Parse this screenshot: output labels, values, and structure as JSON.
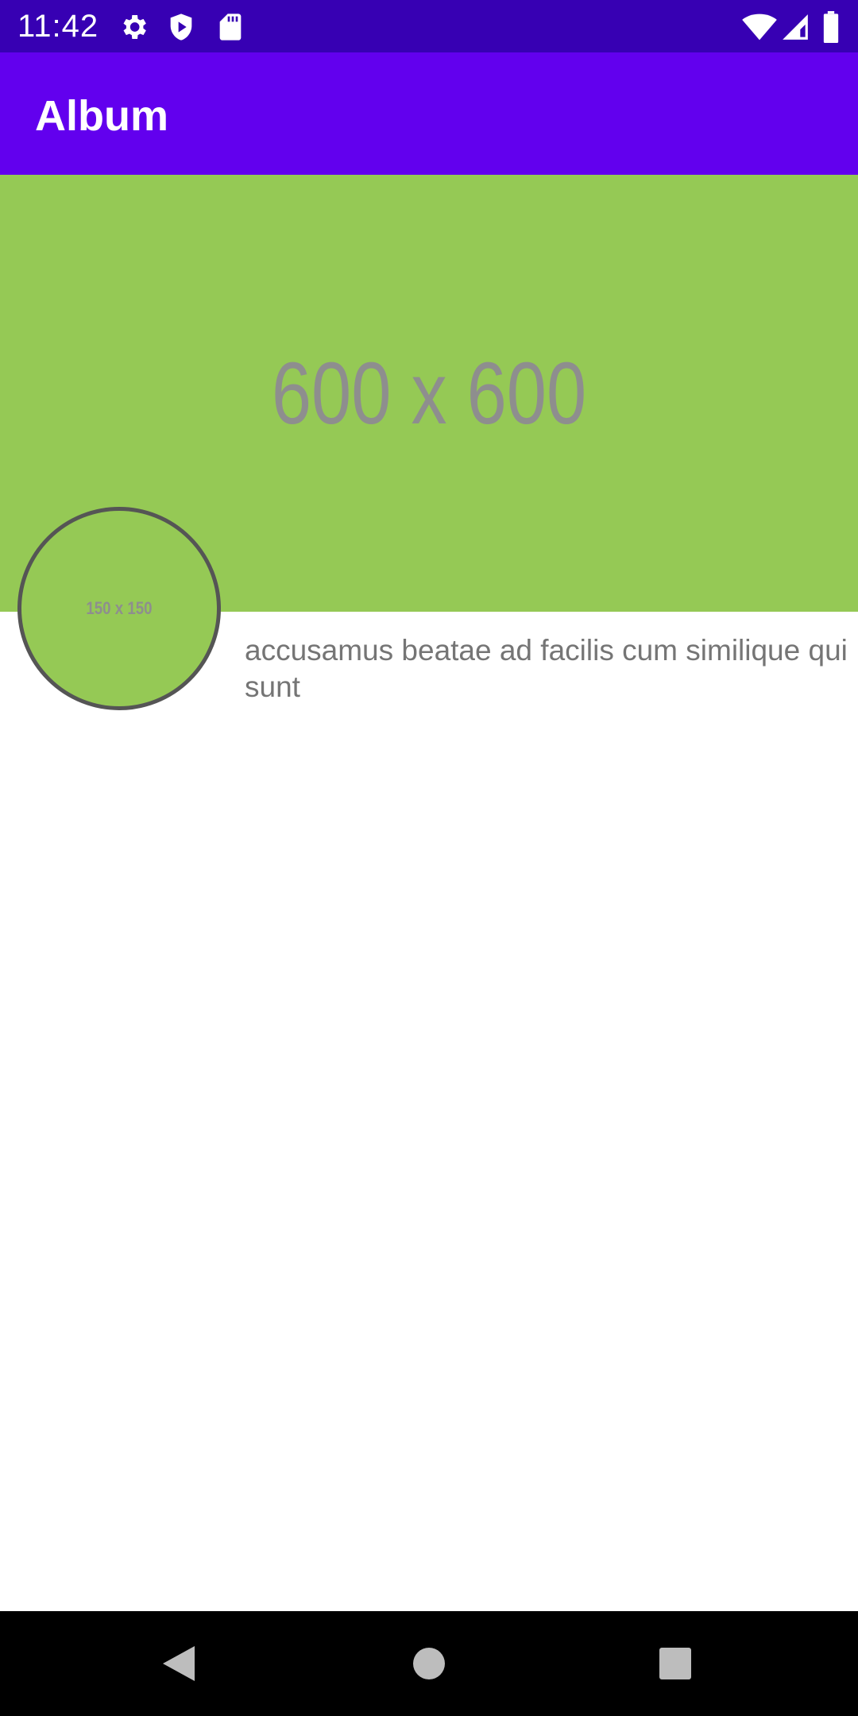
{
  "status_bar": {
    "time": "11:42",
    "icons_left": [
      "gear-icon",
      "shield-play-icon",
      "sd-card-icon"
    ],
    "icons_right": [
      "wifi-icon",
      "signal-icon",
      "battery-icon"
    ]
  },
  "app_bar": {
    "title": "Album"
  },
  "album": {
    "cover_placeholder": "600 x 600",
    "thumbnail_placeholder": "150 x 150",
    "title": "accusamus beatae ad facilis cum similique qui sunt"
  },
  "nav_bar": {
    "buttons": [
      "back-icon",
      "home-icon",
      "recents-icon"
    ]
  },
  "colors": {
    "status_bar": "#3700B3",
    "app_bar": "#6200EE",
    "placeholder_bg": "#95C955",
    "placeholder_text": "#8E8E8E",
    "body_text": "#757575"
  }
}
